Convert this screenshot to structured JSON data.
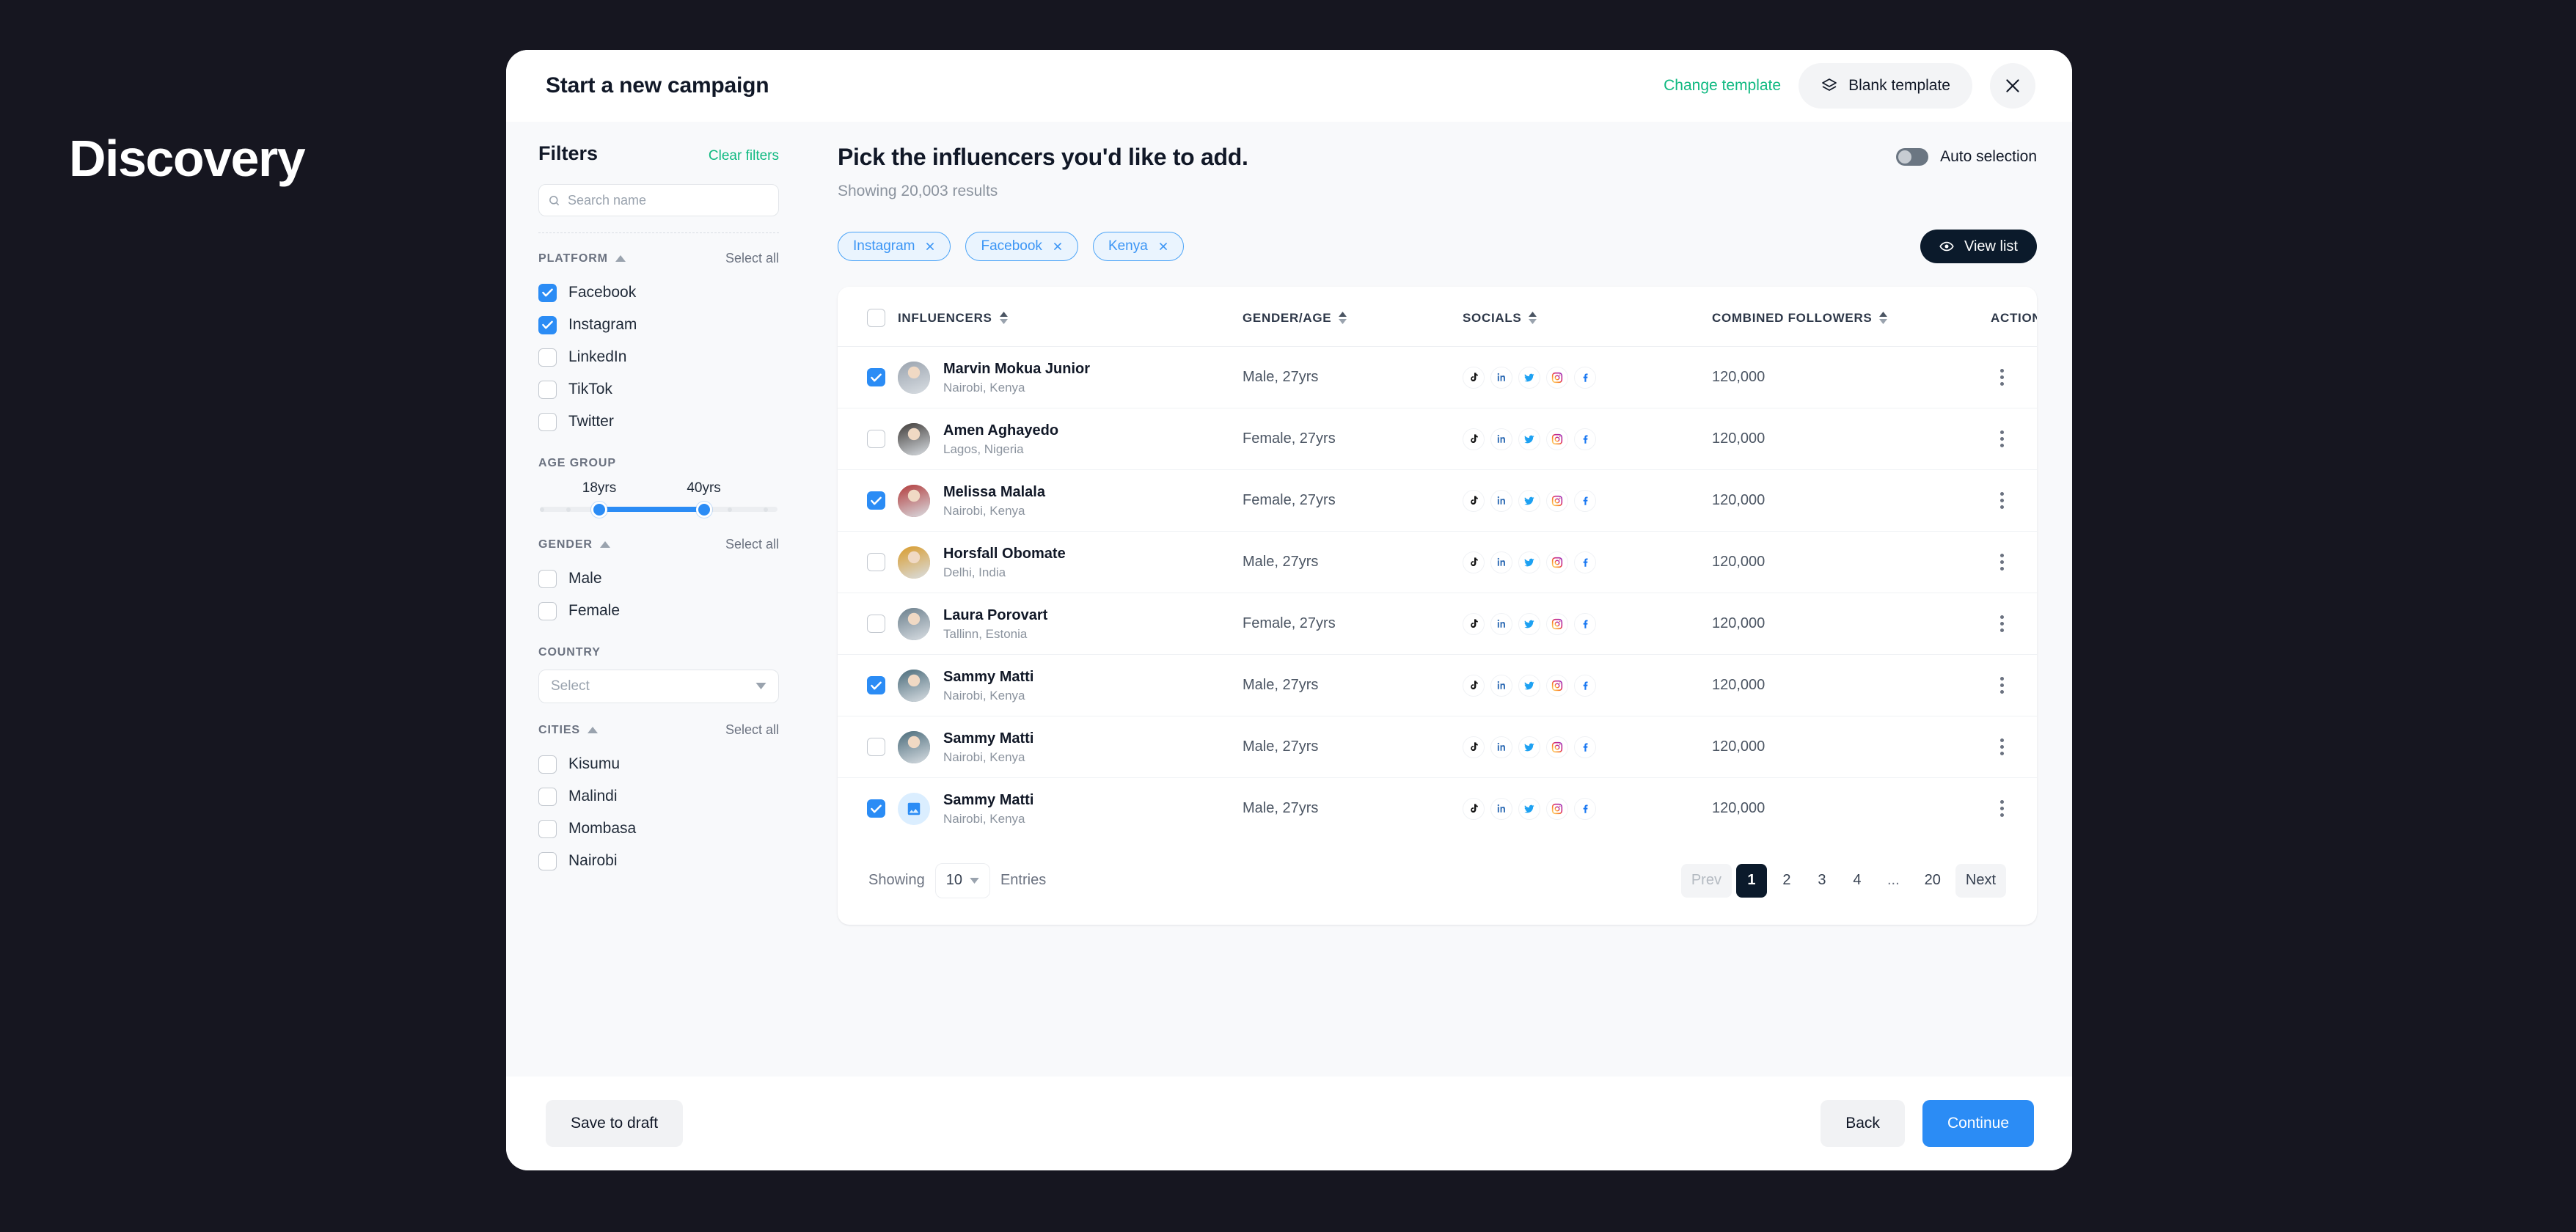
{
  "brand": {
    "label": "Discovery"
  },
  "modal": {
    "title": "Start a new campaign",
    "change_template_label": "Change template",
    "blank_template_label": "Blank template",
    "close_icon": "close-icon",
    "blank_template_icon": "layers-icon"
  },
  "sidebar": {
    "title": "Filters",
    "clear_filters_label": "Clear filters",
    "search": {
      "value": "",
      "placeholder": "Search name",
      "icon": "search-icon"
    },
    "platform": {
      "label": "PLATFORM",
      "select_all_label": "Select all",
      "items": [
        {
          "label": "Facebook",
          "checked": true
        },
        {
          "label": "Instagram",
          "checked": true
        },
        {
          "label": "LinkedIn",
          "checked": false
        },
        {
          "label": "TikTok",
          "checked": false
        },
        {
          "label": "Twitter",
          "checked": false
        }
      ]
    },
    "age_group": {
      "label": "AGE GROUP",
      "min_label": "18yrs",
      "max_label": "40yrs",
      "min_value": 18,
      "max_value": 40,
      "range_start_pct": 25,
      "range_end_pct": 69
    },
    "gender": {
      "label": "GENDER",
      "select_all_label": "Select all",
      "items": [
        {
          "label": "Male",
          "checked": false
        },
        {
          "label": "Female",
          "checked": false
        }
      ]
    },
    "country": {
      "label": "COUNTRY",
      "placeholder": "Select",
      "value": ""
    },
    "cities": {
      "label": "CITIES",
      "select_all_label": "Select all",
      "items": [
        {
          "label": "Kisumu",
          "checked": false
        },
        {
          "label": "Malindi",
          "checked": false
        },
        {
          "label": "Mombasa",
          "checked": false
        },
        {
          "label": "Nairobi",
          "checked": false
        }
      ]
    }
  },
  "main": {
    "title": "Pick the influencers you'd like to add.",
    "subtitle": "Showing 20,003 results",
    "auto_selection": {
      "label": "Auto selection",
      "enabled": false
    },
    "chips": [
      {
        "label": "Instagram"
      },
      {
        "label": "Facebook"
      },
      {
        "label": "Kenya"
      }
    ],
    "view_list_label": "View list",
    "view_list_icon": "eye-icon",
    "table": {
      "columns": [
        {
          "key": "check",
          "label": "",
          "sortable": false
        },
        {
          "key": "influencers",
          "label": "INFLUENCERS",
          "sortable": true
        },
        {
          "key": "gender_age",
          "label": "GENDER/AGE",
          "sortable": true
        },
        {
          "key": "socials",
          "label": "SOCIALS",
          "sortable": true
        },
        {
          "key": "combined_followers",
          "label": "COMBINED FOLLOWERS",
          "sortable": true
        },
        {
          "key": "action",
          "label": "ACTION",
          "sortable": false
        }
      ],
      "header_checkbox_checked": false,
      "socials_icons": [
        "tiktok-icon",
        "linkedin-icon",
        "twitter-icon",
        "instagram-icon",
        "facebook-icon"
      ],
      "rows": [
        {
          "checked": true,
          "name": "Marvin Mokua Junior",
          "location": "Nairobi, Kenya",
          "gender_age": "Male, 27yrs",
          "combined_followers": "120,000",
          "avatar_type": "photo"
        },
        {
          "checked": false,
          "name": "Amen Aghayedo",
          "location": "Lagos, Nigeria",
          "gender_age": "Female, 27yrs",
          "combined_followers": "120,000",
          "avatar_type": "photo"
        },
        {
          "checked": true,
          "name": "Melissa Malala",
          "location": "Nairobi, Kenya",
          "gender_age": "Female, 27yrs",
          "combined_followers": "120,000",
          "avatar_type": "photo"
        },
        {
          "checked": false,
          "name": "Horsfall Obomate",
          "location": "Delhi, India",
          "gender_age": "Male, 27yrs",
          "combined_followers": "120,000",
          "avatar_type": "photo"
        },
        {
          "checked": false,
          "name": "Laura Porovart",
          "location": "Tallinn, Estonia",
          "gender_age": "Female, 27yrs",
          "combined_followers": "120,000",
          "avatar_type": "photo"
        },
        {
          "checked": true,
          "name": "Sammy Matti",
          "location": "Nairobi, Kenya",
          "gender_age": "Male, 27yrs",
          "combined_followers": "120,000",
          "avatar_type": "photo"
        },
        {
          "checked": false,
          "name": "Sammy Matti",
          "location": "Nairobi, Kenya",
          "gender_age": "Male, 27yrs",
          "combined_followers": "120,000",
          "avatar_type": "photo"
        },
        {
          "checked": true,
          "name": "Sammy Matti",
          "location": "Nairobi, Kenya",
          "gender_age": "Male, 27yrs",
          "combined_followers": "120,000",
          "avatar_type": "placeholder"
        }
      ]
    },
    "pagination": {
      "showing_label": "Showing",
      "entries_value": "10",
      "entries_label": "Entries",
      "prev_label": "Prev",
      "next_label": "Next",
      "pages": [
        "1",
        "2",
        "3",
        "4",
        "...",
        "20"
      ],
      "current_page": "1"
    }
  },
  "footer": {
    "save_draft_label": "Save to draft",
    "back_label": "Back",
    "continue_label": "Continue"
  },
  "colors": {
    "backdrop": "#161620",
    "accent_blue": "#2b8cf5",
    "accent_green": "#10b981",
    "dark": "#0b1a2b",
    "chip_blue": "#3b95f5"
  }
}
